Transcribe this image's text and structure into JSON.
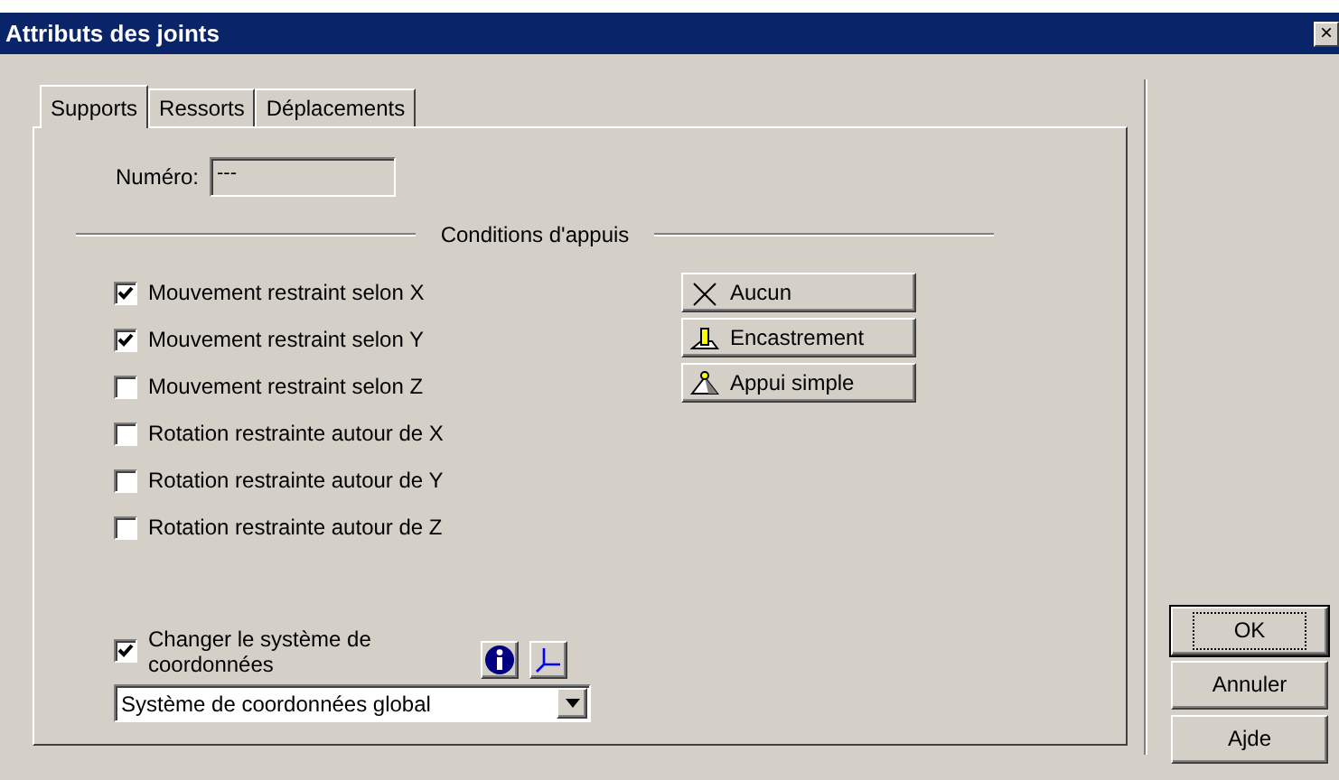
{
  "window": {
    "title": "Attributs des joints",
    "close": "×"
  },
  "tabs": [
    {
      "label": "Supports",
      "selected": true
    },
    {
      "label": "Ressorts",
      "selected": false
    },
    {
      "label": "Déplacements",
      "selected": false
    }
  ],
  "number": {
    "label": "Numéro:",
    "value": "---"
  },
  "section": {
    "title": "Conditions d'appuis"
  },
  "conditions": [
    {
      "label": "Mouvement restraint selon X",
      "checked": true
    },
    {
      "label": "Mouvement restraint selon Y",
      "checked": true
    },
    {
      "label": "Mouvement restraint selon Z",
      "checked": false
    },
    {
      "label": "Rotation restrainte autour de X",
      "checked": false
    },
    {
      "label": "Rotation restrainte autour de Y",
      "checked": false
    },
    {
      "label": "Rotation restrainte autour de Z",
      "checked": false
    }
  ],
  "presets": [
    {
      "kind": "none",
      "label": "Aucun"
    },
    {
      "kind": "fixed",
      "label": "Encastrement"
    },
    {
      "kind": "pinned",
      "label": "Appui simple"
    }
  ],
  "coordinates": {
    "label": "Changer le système de coordonnées",
    "checked": true,
    "value": "Système de coordonnées global"
  },
  "buttons": [
    {
      "label": "OK",
      "default": true
    },
    {
      "label": "Annuler",
      "default": false
    },
    {
      "label": "Ajde",
      "default": false
    }
  ]
}
